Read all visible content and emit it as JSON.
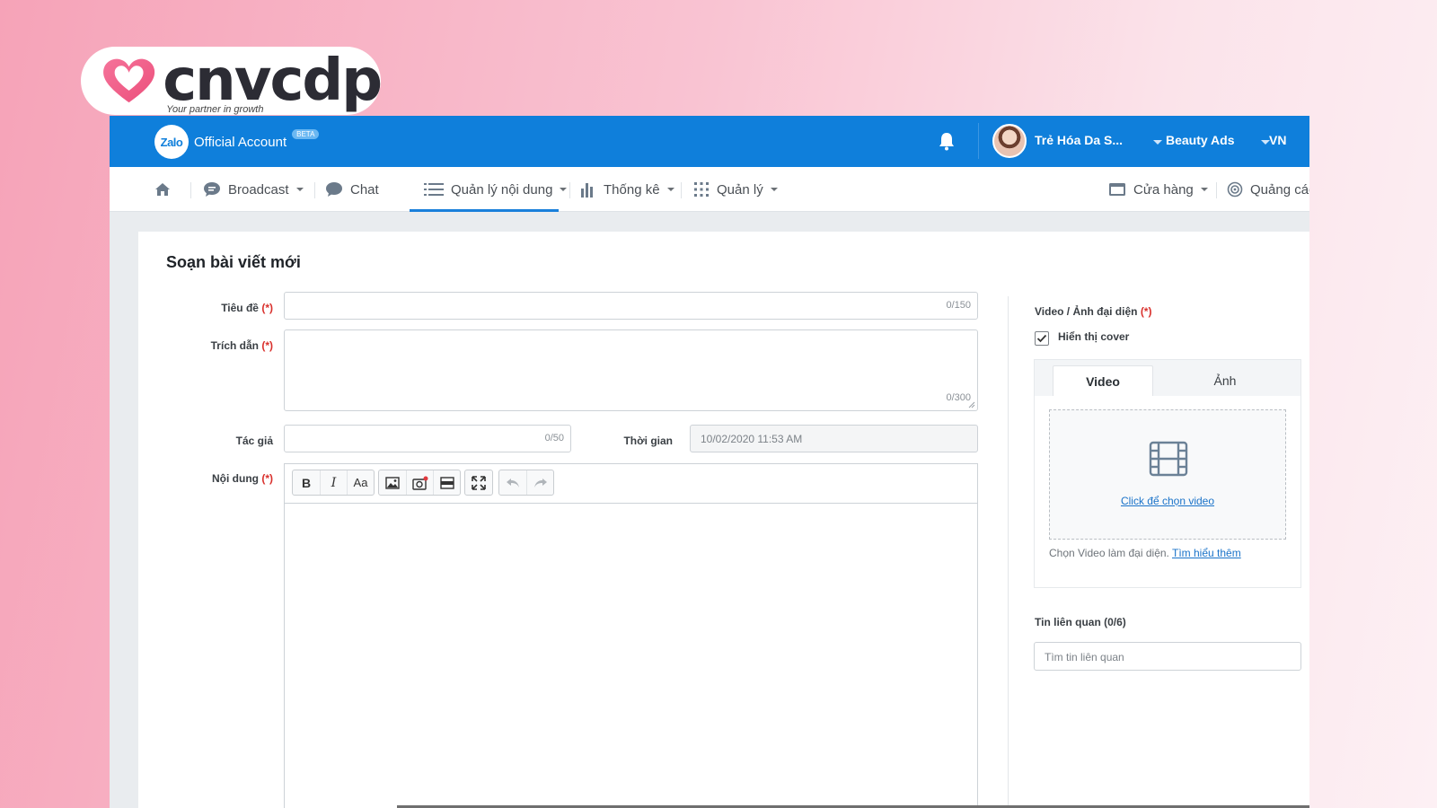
{
  "brand": {
    "logo_text": "cnvcdp",
    "tagline": "Your partner in growth"
  },
  "topbar": {
    "product_logo": "Zalo",
    "product_name": "Official Account",
    "beta_badge": "BETA",
    "user_name": "Trẻ Hóa Da S...",
    "account_menu": "Beauty Ads",
    "language": "VN",
    "color": "#0f7fdb"
  },
  "nav": {
    "items": [
      {
        "label": "Broadcast",
        "icon": "broadcast-bubble-icon"
      },
      {
        "label": "Chat",
        "icon": "chat-bubble-icon"
      },
      {
        "label": "Quản lý nội dung",
        "icon": "list-icon",
        "active": true
      },
      {
        "label": "Thống kê",
        "icon": "bar-chart-icon"
      },
      {
        "label": "Quản lý",
        "icon": "grid-icon"
      },
      {
        "label": "Cửa hàng",
        "icon": "store-icon"
      },
      {
        "label": "Quảng cáo",
        "icon": "target-icon"
      }
    ]
  },
  "form": {
    "title": "Soạn bài viết mới",
    "required_mark": "(*)",
    "title_label": "Tiêu đề",
    "title_counter": "0/150",
    "excerpt_label": "Trích dẫn",
    "excerpt_counter": "0/300",
    "author_label": "Tác giả",
    "author_counter": "0/50",
    "time_label": "Thời gian",
    "time_value": "10/02/2020 11:53 AM",
    "content_label": "Nội dung",
    "toolbar": {
      "bold": "B",
      "italic": "I",
      "font_size": "Aa"
    }
  },
  "sidebar": {
    "cover_label": "Video / Ảnh đại diện",
    "show_cover_label": "Hiển thị cover",
    "show_cover_checked": true,
    "tab_video": "Video",
    "tab_image": "Ảnh",
    "choose_video_link": "Click để chọn video",
    "hint_text": "Chọn Video làm đại diện.",
    "hint_link": "Tìm hiểu thêm",
    "related_label": "Tin liên quan (0/6)",
    "related_placeholder": "Tìm tin liên quan"
  }
}
